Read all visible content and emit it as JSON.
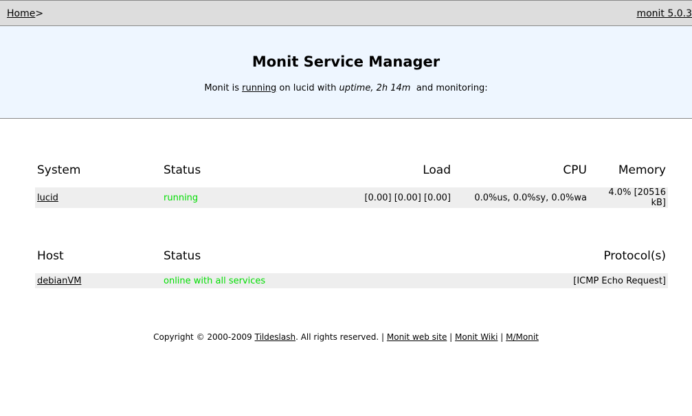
{
  "nav": {
    "home": "Home",
    "separator": ">",
    "version": "monit 5.0.3"
  },
  "header": {
    "title": "Monit Service Manager",
    "status_prefix": "Monit is",
    "status_link": "running",
    "status_host": "on lucid with",
    "uptime_label": "uptime,",
    "uptime_value": "2h 14m",
    "status_suffix": "and monitoring:"
  },
  "system_table": {
    "headers": [
      "System",
      "Status",
      "Load",
      "CPU",
      "Memory"
    ],
    "row": {
      "name": "lucid",
      "status": "running",
      "load": "[0.00] [0.00] [0.00]",
      "cpu": "0.0%us, 0.0%sy, 0.0%wa",
      "memory": "4.0% [20516 kB]"
    }
  },
  "host_table": {
    "headers": [
      "Host",
      "Status",
      "Protocol(s)"
    ],
    "row": {
      "name": "debianVM",
      "status": "online with all services",
      "protocols": "[ICMP Echo Request]"
    }
  },
  "footer": {
    "copyright": "Copyright © 2000-2009",
    "company": "Tildeslash",
    "rights": ". All rights reserved. |",
    "link1": "Monit web site",
    "sep1": "|",
    "link2": "Monit Wiki",
    "sep2": "|",
    "link3": "M/Monit"
  },
  "colors": {
    "navbar": "#dddddd",
    "header": "#eef6ff",
    "status_ok": "#00dd00",
    "row": "#eeeeee"
  }
}
